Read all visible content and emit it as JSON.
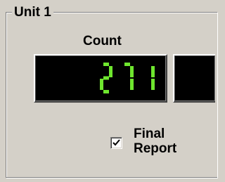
{
  "group": {
    "title": "Unit 1"
  },
  "counter": {
    "label": "Count",
    "value": "271",
    "digit_color": "#6ee62e",
    "display_bg": "#000000"
  },
  "final_report": {
    "line1": "Final",
    "line2": "Report",
    "checked": true
  },
  "colors": {
    "face": "#d4d0c8"
  }
}
